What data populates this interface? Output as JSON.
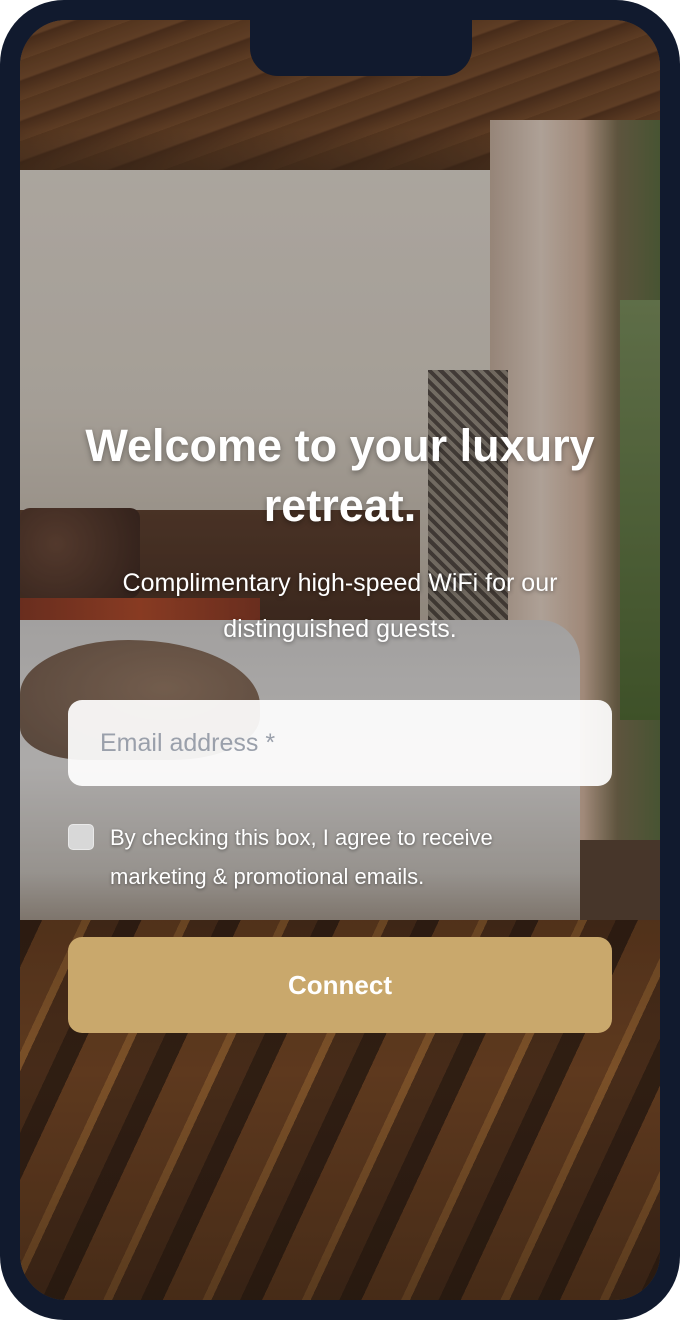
{
  "portal": {
    "title": "Welcome to your luxury retreat.",
    "subtitle": "Complimentary high-speed WiFi for our distinguished guests.",
    "email_placeholder": "Email address *",
    "email_value": "",
    "consent_checked": false,
    "consent_text": "By checking this box, I agree to receive marketing & promotional emails.",
    "connect_label": "Connect"
  },
  "colors": {
    "accent": "#c9a86c",
    "device_frame": "#111a2e",
    "text": "#ffffff",
    "placeholder": "#9aa0ab"
  }
}
